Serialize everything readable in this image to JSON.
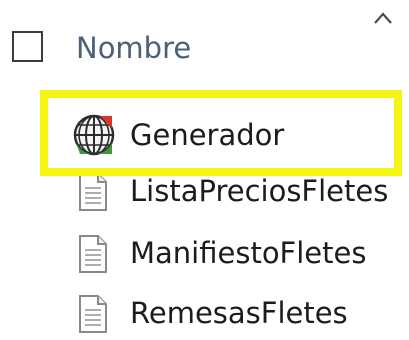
{
  "header": {
    "column_name": "Nombre",
    "sort_icon": "chevron-up-icon"
  },
  "files": [
    {
      "name": "Generador",
      "icon": "application-globe-icon",
      "highlighted": true
    },
    {
      "name": "ListaPreciosFletes",
      "icon": "text-document-icon",
      "highlighted": false
    },
    {
      "name": "ManifiestoFletes",
      "icon": "text-document-icon",
      "highlighted": false
    },
    {
      "name": "RemesasFletes",
      "icon": "text-document-icon",
      "highlighted": false
    }
  ],
  "colors": {
    "highlight": "#f5f50f",
    "header_text": "#4c607a"
  }
}
